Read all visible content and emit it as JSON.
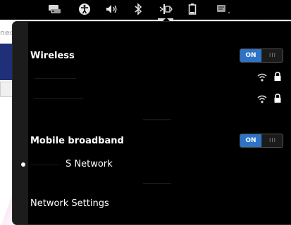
{
  "background": {
    "tab_text": "ned-stripeb"
  },
  "topbar": {
    "icons": [
      {
        "name": "network-cards-icon",
        "glyph": "🖴"
      },
      {
        "name": "accessibility-icon",
        "glyph": "✪"
      },
      {
        "name": "volume-icon",
        "glyph": "🔊"
      },
      {
        "name": "bluetooth-icon",
        "glyph": "ᛒ"
      },
      {
        "name": "network-indicator-icon",
        "glyph": "⧗"
      },
      {
        "name": "battery-icon",
        "glyph": "▯"
      },
      {
        "name": "chat-icon",
        "glyph": "▣"
      }
    ]
  },
  "menu": {
    "wireless": {
      "title": "Wireless",
      "toggle_on": "ON",
      "toggle_knob": "III",
      "networks": [
        {
          "label": "",
          "secured": true
        },
        {
          "label": "",
          "secured": true
        }
      ]
    },
    "mobile_broadband": {
      "title": "Mobile broadband",
      "toggle_on": "ON",
      "toggle_knob": "III",
      "network_label": "S Network"
    },
    "settings_label": "Network Settings"
  },
  "colors": {
    "accent": "#2f73c7",
    "menu_bg": "#000000",
    "text": "#ffffff"
  }
}
